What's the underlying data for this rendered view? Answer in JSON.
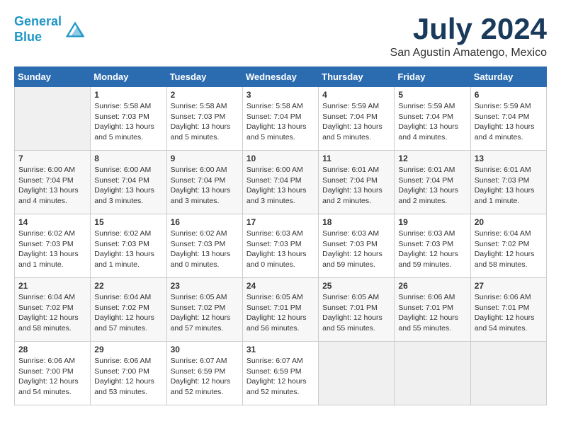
{
  "logo": {
    "line1": "General",
    "line2": "Blue"
  },
  "title": "July 2024",
  "location": "San Agustin Amatengo, Mexico",
  "weekdays": [
    "Sunday",
    "Monday",
    "Tuesday",
    "Wednesday",
    "Thursday",
    "Friday",
    "Saturday"
  ],
  "weeks": [
    [
      {
        "day": "",
        "info": ""
      },
      {
        "day": "1",
        "info": "Sunrise: 5:58 AM\nSunset: 7:03 PM\nDaylight: 13 hours\nand 5 minutes."
      },
      {
        "day": "2",
        "info": "Sunrise: 5:58 AM\nSunset: 7:03 PM\nDaylight: 13 hours\nand 5 minutes."
      },
      {
        "day": "3",
        "info": "Sunrise: 5:58 AM\nSunset: 7:04 PM\nDaylight: 13 hours\nand 5 minutes."
      },
      {
        "day": "4",
        "info": "Sunrise: 5:59 AM\nSunset: 7:04 PM\nDaylight: 13 hours\nand 5 minutes."
      },
      {
        "day": "5",
        "info": "Sunrise: 5:59 AM\nSunset: 7:04 PM\nDaylight: 13 hours\nand 4 minutes."
      },
      {
        "day": "6",
        "info": "Sunrise: 5:59 AM\nSunset: 7:04 PM\nDaylight: 13 hours\nand 4 minutes."
      }
    ],
    [
      {
        "day": "7",
        "info": "Sunrise: 6:00 AM\nSunset: 7:04 PM\nDaylight: 13 hours\nand 4 minutes."
      },
      {
        "day": "8",
        "info": "Sunrise: 6:00 AM\nSunset: 7:04 PM\nDaylight: 13 hours\nand 3 minutes."
      },
      {
        "day": "9",
        "info": "Sunrise: 6:00 AM\nSunset: 7:04 PM\nDaylight: 13 hours\nand 3 minutes."
      },
      {
        "day": "10",
        "info": "Sunrise: 6:00 AM\nSunset: 7:04 PM\nDaylight: 13 hours\nand 3 minutes."
      },
      {
        "day": "11",
        "info": "Sunrise: 6:01 AM\nSunset: 7:04 PM\nDaylight: 13 hours\nand 2 minutes."
      },
      {
        "day": "12",
        "info": "Sunrise: 6:01 AM\nSunset: 7:04 PM\nDaylight: 13 hours\nand 2 minutes."
      },
      {
        "day": "13",
        "info": "Sunrise: 6:01 AM\nSunset: 7:03 PM\nDaylight: 13 hours\nand 1 minute."
      }
    ],
    [
      {
        "day": "14",
        "info": "Sunrise: 6:02 AM\nSunset: 7:03 PM\nDaylight: 13 hours\nand 1 minute."
      },
      {
        "day": "15",
        "info": "Sunrise: 6:02 AM\nSunset: 7:03 PM\nDaylight: 13 hours\nand 1 minute."
      },
      {
        "day": "16",
        "info": "Sunrise: 6:02 AM\nSunset: 7:03 PM\nDaylight: 13 hours\nand 0 minutes."
      },
      {
        "day": "17",
        "info": "Sunrise: 6:03 AM\nSunset: 7:03 PM\nDaylight: 13 hours\nand 0 minutes."
      },
      {
        "day": "18",
        "info": "Sunrise: 6:03 AM\nSunset: 7:03 PM\nDaylight: 12 hours\nand 59 minutes."
      },
      {
        "day": "19",
        "info": "Sunrise: 6:03 AM\nSunset: 7:03 PM\nDaylight: 12 hours\nand 59 minutes."
      },
      {
        "day": "20",
        "info": "Sunrise: 6:04 AM\nSunset: 7:02 PM\nDaylight: 12 hours\nand 58 minutes."
      }
    ],
    [
      {
        "day": "21",
        "info": "Sunrise: 6:04 AM\nSunset: 7:02 PM\nDaylight: 12 hours\nand 58 minutes."
      },
      {
        "day": "22",
        "info": "Sunrise: 6:04 AM\nSunset: 7:02 PM\nDaylight: 12 hours\nand 57 minutes."
      },
      {
        "day": "23",
        "info": "Sunrise: 6:05 AM\nSunset: 7:02 PM\nDaylight: 12 hours\nand 57 minutes."
      },
      {
        "day": "24",
        "info": "Sunrise: 6:05 AM\nSunset: 7:01 PM\nDaylight: 12 hours\nand 56 minutes."
      },
      {
        "day": "25",
        "info": "Sunrise: 6:05 AM\nSunset: 7:01 PM\nDaylight: 12 hours\nand 55 minutes."
      },
      {
        "day": "26",
        "info": "Sunrise: 6:06 AM\nSunset: 7:01 PM\nDaylight: 12 hours\nand 55 minutes."
      },
      {
        "day": "27",
        "info": "Sunrise: 6:06 AM\nSunset: 7:01 PM\nDaylight: 12 hours\nand 54 minutes."
      }
    ],
    [
      {
        "day": "28",
        "info": "Sunrise: 6:06 AM\nSunset: 7:00 PM\nDaylight: 12 hours\nand 54 minutes."
      },
      {
        "day": "29",
        "info": "Sunrise: 6:06 AM\nSunset: 7:00 PM\nDaylight: 12 hours\nand 53 minutes."
      },
      {
        "day": "30",
        "info": "Sunrise: 6:07 AM\nSunset: 6:59 PM\nDaylight: 12 hours\nand 52 minutes."
      },
      {
        "day": "31",
        "info": "Sunrise: 6:07 AM\nSunset: 6:59 PM\nDaylight: 12 hours\nand 52 minutes."
      },
      {
        "day": "",
        "info": ""
      },
      {
        "day": "",
        "info": ""
      },
      {
        "day": "",
        "info": ""
      }
    ]
  ]
}
